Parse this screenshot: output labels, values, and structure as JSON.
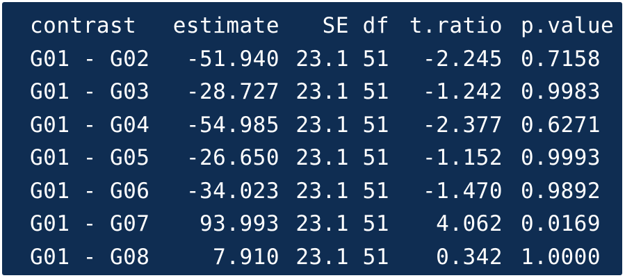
{
  "table": {
    "headers": {
      "contrast": "contrast",
      "estimate": "estimate",
      "se": "SE",
      "df": "df",
      "t_ratio": "t.ratio",
      "p_value": "p.value"
    },
    "rows": [
      {
        "contrast": "G01 - G02",
        "estimate": "-51.940",
        "se": "23.1",
        "df": "51",
        "t_ratio": "-2.245",
        "p_value": "0.7158"
      },
      {
        "contrast": "G01 - G03",
        "estimate": "-28.727",
        "se": "23.1",
        "df": "51",
        "t_ratio": "-1.242",
        "p_value": "0.9983"
      },
      {
        "contrast": "G01 - G04",
        "estimate": "-54.985",
        "se": "23.1",
        "df": "51",
        "t_ratio": "-2.377",
        "p_value": "0.6271"
      },
      {
        "contrast": "G01 - G05",
        "estimate": "-26.650",
        "se": "23.1",
        "df": "51",
        "t_ratio": "-1.152",
        "p_value": "0.9993"
      },
      {
        "contrast": "G01 - G06",
        "estimate": "-34.023",
        "se": "23.1",
        "df": "51",
        "t_ratio": "-1.470",
        "p_value": "0.9892"
      },
      {
        "contrast": "G01 - G07",
        "estimate": "93.993",
        "se": "23.1",
        "df": "51",
        "t_ratio": "4.062",
        "p_value": "0.0169"
      },
      {
        "contrast": "G01 - G08",
        "estimate": "7.910",
        "se": "23.1",
        "df": "51",
        "t_ratio": "0.342",
        "p_value": "1.0000"
      }
    ]
  },
  "colors": {
    "background": "#0f2d52",
    "text": "#ffffff"
  }
}
